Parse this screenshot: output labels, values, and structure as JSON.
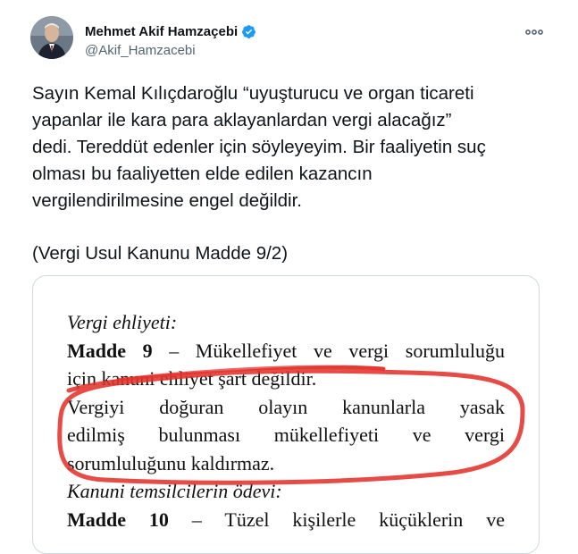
{
  "author": {
    "display_name": "Mehmet Akif Hamzaçebi",
    "handle": "@Akif_Hamzacebi",
    "verified_icon": "verified-badge-icon",
    "avatar": "avatar-photo"
  },
  "colors": {
    "verified": "#1d9bf0",
    "text": "#0f1419",
    "secondary": "#536471",
    "highlight": "#e3322b"
  },
  "tweet": {
    "paragraph": "Sayın Kemal Kılıçdaroğlu “uyuşturucu ve organ ticareti\nyapanlar ile kara para aklayanlardan vergi alacağız”\ndedi. Tereddüt edenler için söyleyeyim. Bir faaliyetin suç\nolması bu faaliyetten  elde edilen kazancın\nvergilendirilmesine engel değildir.",
    "citation": "(Vergi Usul Kanunu Madde 9/2)"
  },
  "document": {
    "heading1": "Vergi ehliyeti:",
    "madde9_label": "Madde 9",
    "madde9_rest": " – Mükellefiyet ve vergi sorumluluğu",
    "line3": "için kanuni ehliyet şart değildir.",
    "line4": "Vergiyi doğuran olayın kanunlarla yasak",
    "line5": "edilmiş bulunması mükellefiyeti ve vergi",
    "line6": "sorumluluğunu kaldırmaz.",
    "heading2": "Kanuni temsilcilerin ödevi:",
    "madde10_label": "Madde 10",
    "madde10_rest": " – Tüzel kişilerle küçüklerin ve"
  }
}
